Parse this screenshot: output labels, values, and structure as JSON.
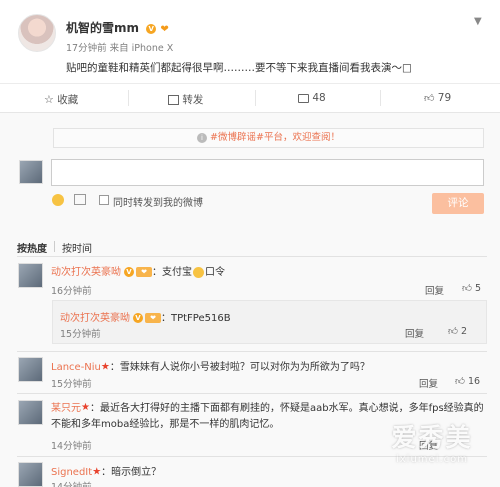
{
  "post": {
    "author": "机智的雪mm",
    "meta": "17分钟前 来自 iPhone X",
    "text": "贴吧的童鞋和精英们都起得很早啊………要不等下来我直播间看我表演～□",
    "menu_icon": "chevron-down-icon"
  },
  "actions": {
    "favorite": "收藏",
    "repost": "转发",
    "comment_count": "48",
    "like_count": "79"
  },
  "notice": {
    "text": "#微博辟谣#平台，欢迎查阅！"
  },
  "composer": {
    "placeholder": "",
    "repost_label": "同时转发到我的微博",
    "submit_label": "评论"
  },
  "sort": {
    "hot": "按热度",
    "time": "按时间"
  },
  "comments": [
    {
      "name": "动次打次英豪呦",
      "text": "：支付宝",
      "emoji_text": "口令",
      "time": "16分钟前",
      "reply": "回复",
      "likes": "5"
    },
    {
      "name": "动次打次英豪呦",
      "text": "：TPtFPe516B",
      "time": "15分钟前",
      "reply": "回复",
      "likes": "2"
    },
    {
      "name": "Lance-Niu",
      "text": "：雪妹妹有人说你小号被封啦？可以对你为为所欲为了吗？",
      "time": "15分钟前",
      "reply": "回复",
      "likes": "16"
    },
    {
      "name": "某只元",
      "text": "：最近各大打得好的主播下面都有刷挂的，怀疑是aab水军。真心想说，多年fps经验真的不能和多年moba经验比，那是不一样的肌肉记忆。",
      "time": "14分钟前",
      "reply": "回复"
    },
    {
      "name": "SignedIt",
      "text": "：暗示倒立？",
      "time": "14分钟前"
    }
  ],
  "watermark": {
    "text": "爱秀美",
    "url": "ixiumei.com"
  }
}
